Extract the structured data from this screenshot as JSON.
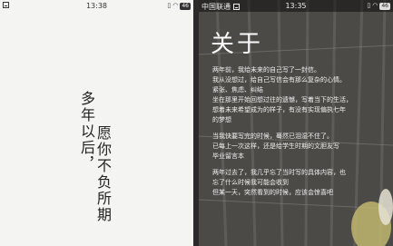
{
  "left_screen": {
    "status": {
      "time": "13:38",
      "battery": "46"
    },
    "poem": {
      "column1": "多年以后，",
      "column2": "愿你不负所期"
    }
  },
  "right_screen": {
    "status": {
      "carrier": "中国联通",
      "time": "13:35",
      "battery": "46"
    },
    "title": "关于",
    "paragraphs": [
      [
        "两年前，我给未来的自己写了一封信。",
        "我从没想过，给自己写信会有那么复杂的心情。",
        "紧张、焦虑、纠结",
        "坐在那里开始回想过往的遗憾，写着当下的生活，",
        "想着未来希望成为的样子，有没有实现偏执七年",
        "的梦想"
      ],
      [
        "当我快要写完的时候，蓦然已泪湿不住了。",
        "已每上一次这样，还是给学生时期的文胆友写",
        "毕业留言本"
      ],
      [
        "两年过去了，我几乎忘了当时写的具体内容，也",
        "忘了什么时候我可能会收到",
        "但某一天，突然看到的时候，应该会惊喜吧"
      ]
    ]
  }
}
